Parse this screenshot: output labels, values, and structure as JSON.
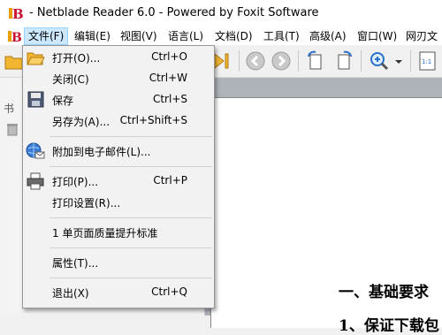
{
  "window": {
    "title": "- Netblade Reader 6.0 - Powered by Foxit Software"
  },
  "menubar": {
    "items": [
      {
        "label": "文件(F)",
        "active": true
      },
      {
        "label": "编辑(E)"
      },
      {
        "label": "视图(V)"
      },
      {
        "label": "语言(L)"
      },
      {
        "label": "文档(D)"
      },
      {
        "label": "工具(T)"
      },
      {
        "label": "高级(A)"
      },
      {
        "label": "窗口(W)"
      },
      {
        "label": "网刃文"
      }
    ]
  },
  "file_menu": {
    "items": [
      {
        "label": "打开(O)...",
        "shortcut": "Ctrl+O",
        "icon": "open-folder-icon"
      },
      {
        "label": "关闭(C)",
        "shortcut": "Ctrl+W"
      },
      {
        "label": "保存",
        "shortcut": "Ctrl+S",
        "icon": "save-disk-icon"
      },
      {
        "label": "另存为(A)...",
        "shortcut": "Ctrl+Shift+S"
      },
      {
        "label": "附加到电子邮件(L)...",
        "shortcut": "",
        "icon": "email-attach-icon"
      },
      {
        "label": "打印(P)...",
        "shortcut": "Ctrl+P",
        "icon": "printer-icon"
      },
      {
        "label": "打印设置(R)...",
        "shortcut": ""
      },
      {
        "label": "1 单页面质量提升标准",
        "shortcut": ""
      },
      {
        "label": "属性(T)...",
        "shortcut": ""
      },
      {
        "label": "退出(X)",
        "shortcut": "Ctrl+Q"
      }
    ]
  },
  "left_panel": {
    "tab_label": "书"
  },
  "toolbar": {
    "zoom_icon": "zoom-in-icon"
  },
  "document": {
    "heading1": "一、基础要求",
    "heading2": "1、保证下载包"
  },
  "colors": {
    "menu_active_bg": "#cce8ff",
    "menu_active_border": "#99d1ff",
    "doc_bg": "#aeb3ba"
  }
}
